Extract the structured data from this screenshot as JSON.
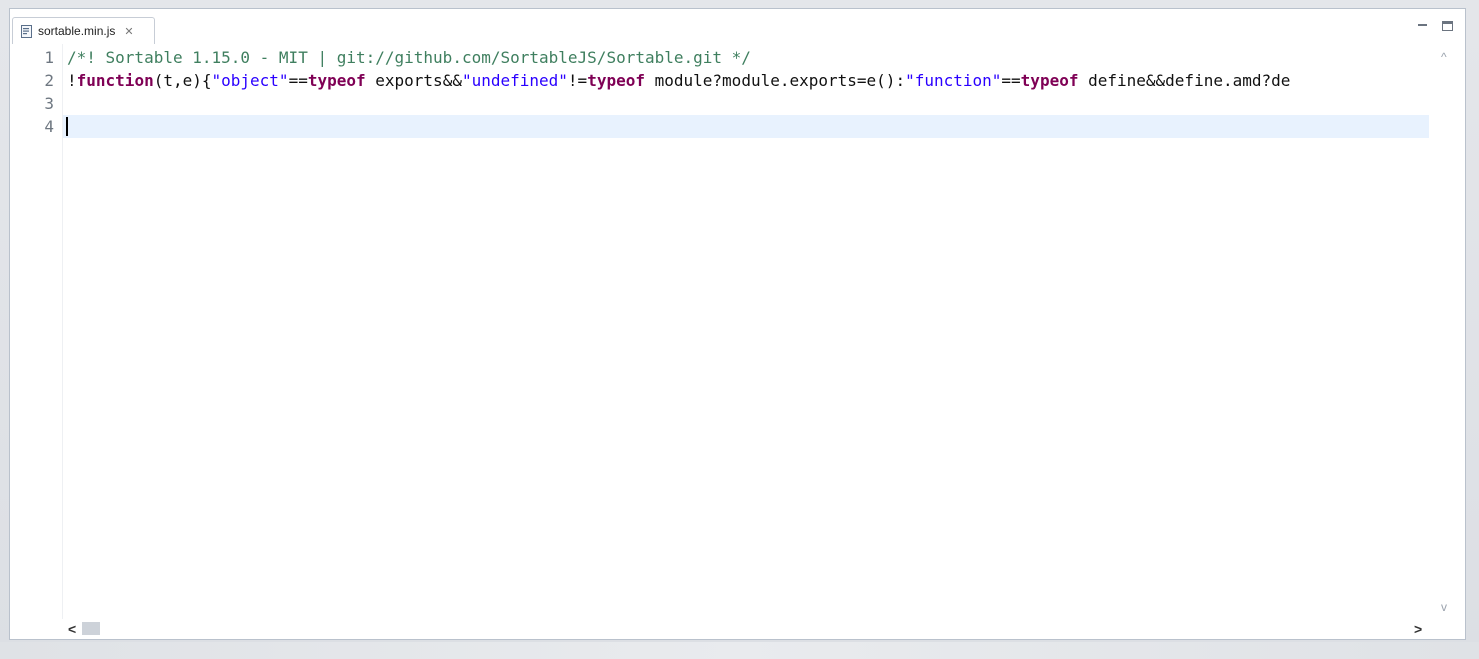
{
  "editor": {
    "tab": {
      "label": "sortable.min.js",
      "close_glyph": "✕",
      "icon": "js-file-icon"
    },
    "window_controls": {
      "minimize": "minimize-icon",
      "maximize": "maximize-icon"
    },
    "line_numbers": [
      "1",
      "2",
      "3",
      "4"
    ],
    "lines": {
      "line1": {
        "comment": "/*! Sortable 1.15.0 - MIT | git://github.com/SortableJS/Sortable.git */"
      },
      "line2": {
        "t1": "!",
        "t2": "function",
        "t3": "(t,e){",
        "t4": "\"object\"",
        "t5": "==",
        "t6": "typeof",
        "t7": " exports&&",
        "t8": "\"undefined\"",
        "t9": "!=",
        "t10": "typeof",
        "t11": " module?module.exports=e():",
        "t12": "\"function\"",
        "t13": "==",
        "t14": "typeof",
        "t15": " define&&define.amd?de"
      }
    },
    "scrollbars": {
      "up": "^",
      "down": "v",
      "left": "<",
      "right": ">"
    },
    "colors": {
      "comment": "#3f7f5f",
      "keyword": "#7f0055",
      "string": "#2a00ff",
      "current_line": "#e8f2fe"
    }
  }
}
